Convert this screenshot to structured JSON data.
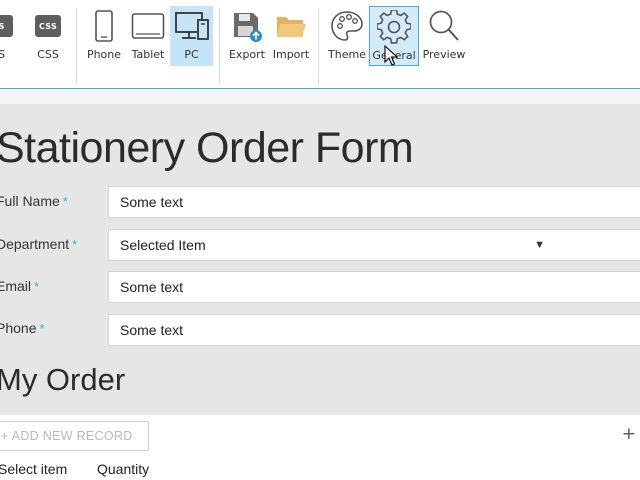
{
  "toolbar": {
    "js_label": "JS",
    "css_label": "CSS",
    "css_chip": "CSS",
    "js_chip": "JS",
    "phone_label": "Phone",
    "tablet_label": "Tablet",
    "pc_label": "PC",
    "export_label": "Export",
    "import_label": "Import",
    "theme_label": "Theme",
    "general_label": "General",
    "preview_label": "Preview",
    "active_item": "PC",
    "hovered_item": "General",
    "accent_color": "#4aa8d8"
  },
  "form": {
    "title": "Stationery Order Form",
    "required_marker": "*",
    "fields": [
      {
        "label": "Full Name",
        "value": "Some text"
      },
      {
        "label": "Department",
        "value": "Selected Item"
      },
      {
        "label": "Email",
        "value": "Some text"
      },
      {
        "label": "Phone",
        "value": "Some text"
      }
    ]
  },
  "order": {
    "title": "My Order",
    "add_record_label": "+ ADD NEW RECORD",
    "add_icon": "+",
    "columns": [
      "Select item",
      "Quantity"
    ]
  }
}
